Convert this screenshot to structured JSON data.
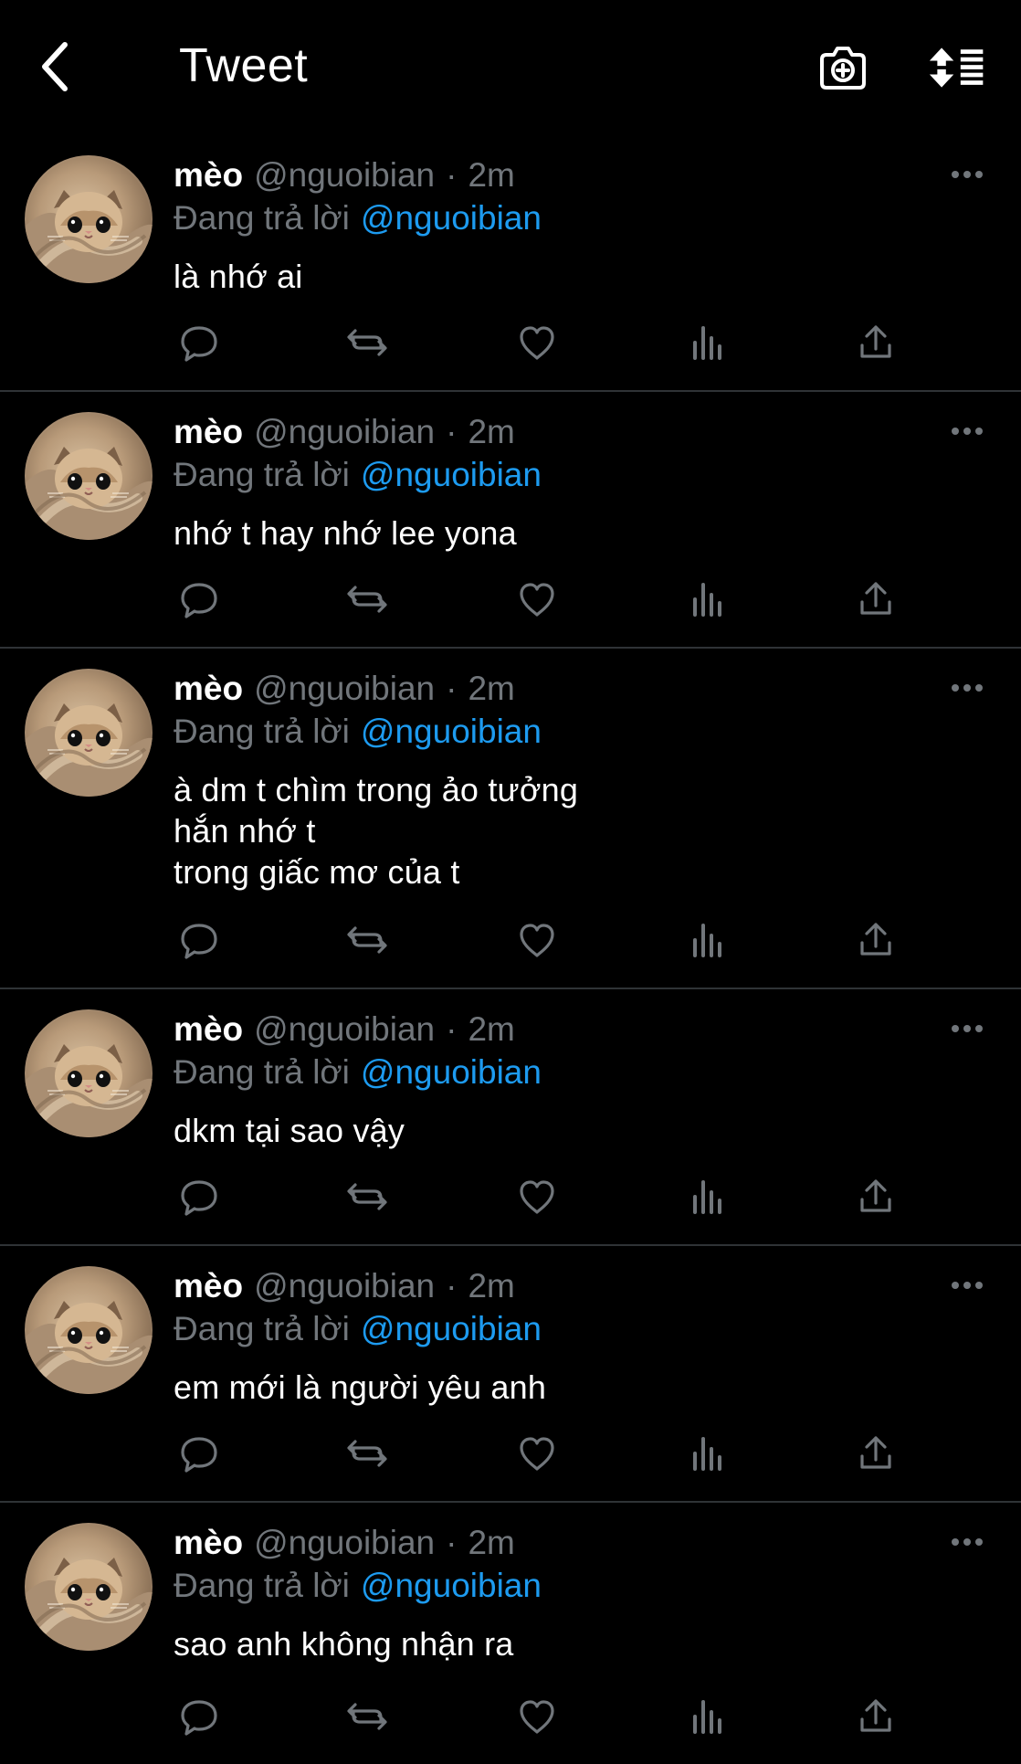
{
  "header": {
    "title": "Tweet",
    "icons": {
      "back": "back-icon",
      "camera": "camera-plus-icon",
      "sort": "sort-icon"
    }
  },
  "colors": {
    "background": "#000000",
    "text_primary": "#ffffff",
    "text_secondary": "#71767b",
    "link": "#1d9bf0",
    "divider": "#2f3336"
  },
  "tweets": [
    {
      "author": "mèo",
      "handle": "@nguoibian",
      "separator": "·",
      "time": "2m",
      "reply_label": "Đang trả lời",
      "reply_to": "@nguoibian",
      "text": "là nhớ ai"
    },
    {
      "author": "mèo",
      "handle": "@nguoibian",
      "separator": "·",
      "time": "2m",
      "reply_label": "Đang trả lời",
      "reply_to": "@nguoibian",
      "text": "nhớ t hay nhớ lee yona"
    },
    {
      "author": "mèo",
      "handle": "@nguoibian",
      "separator": "·",
      "time": "2m",
      "reply_label": "Đang trả lời",
      "reply_to": "@nguoibian",
      "text": "à dm t chìm trong ảo tưởng\nhắn nhớ t\ntrong giấc mơ của t"
    },
    {
      "author": "mèo",
      "handle": "@nguoibian",
      "separator": "·",
      "time": "2m",
      "reply_label": "Đang trả lời",
      "reply_to": "@nguoibian",
      "text": "dkm tại sao vậy"
    },
    {
      "author": "mèo",
      "handle": "@nguoibian",
      "separator": "·",
      "time": "2m",
      "reply_label": "Đang trả lời",
      "reply_to": "@nguoibian",
      "text": "em mới là người yêu anh"
    },
    {
      "author": "mèo",
      "handle": "@nguoibian",
      "separator": "·",
      "time": "2m",
      "reply_label": "Đang trả lời",
      "reply_to": "@nguoibian",
      "text": "sao anh không nhận ra"
    }
  ],
  "tweet_icons": {
    "avatar": "cat-avatar-icon",
    "more": "more-horizontal-icon",
    "reply": "reply-icon",
    "retweet": "retweet-icon",
    "like": "heart-icon",
    "views": "analytics-icon",
    "share": "share-icon"
  }
}
